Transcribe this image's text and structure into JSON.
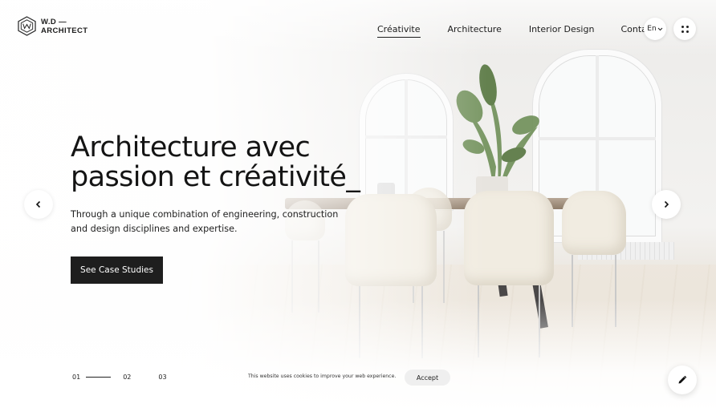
{
  "brand": {
    "line1": "W.D —",
    "line2": "ARCHITECT",
    "logo_icon": "hexagon-monogram-icon"
  },
  "nav": {
    "items": [
      {
        "label": "Créativite",
        "active": true
      },
      {
        "label": "Architecture",
        "active": false
      },
      {
        "label": "Interior Design",
        "active": false
      },
      {
        "label": "Contact",
        "active": false
      }
    ],
    "language": "En",
    "language_icon": "chevron-down-icon",
    "menu_icon": "grid-dots-icon"
  },
  "hero": {
    "title_line1": "Architecture avec",
    "title_line2": "passion et créativité_",
    "subtitle_line1": "Through a unique combination of engineering, construction",
    "subtitle_line2": "and design disciplines and expertise.",
    "cta_label": "See Case Studies"
  },
  "slider": {
    "prev_icon": "chevron-left-icon",
    "next_icon": "chevron-right-icon",
    "pages": [
      "01",
      "02",
      "03"
    ],
    "current": "01"
  },
  "cookie": {
    "text": "This website uses cookies to improve your web experience.",
    "accept_label": "Accept"
  },
  "fab": {
    "icon": "pencil-icon"
  },
  "colors": {
    "text": "#161616",
    "cta_background": "#1e1e1e",
    "cta_text": "#ffffff",
    "accept_background": "#efefef"
  }
}
